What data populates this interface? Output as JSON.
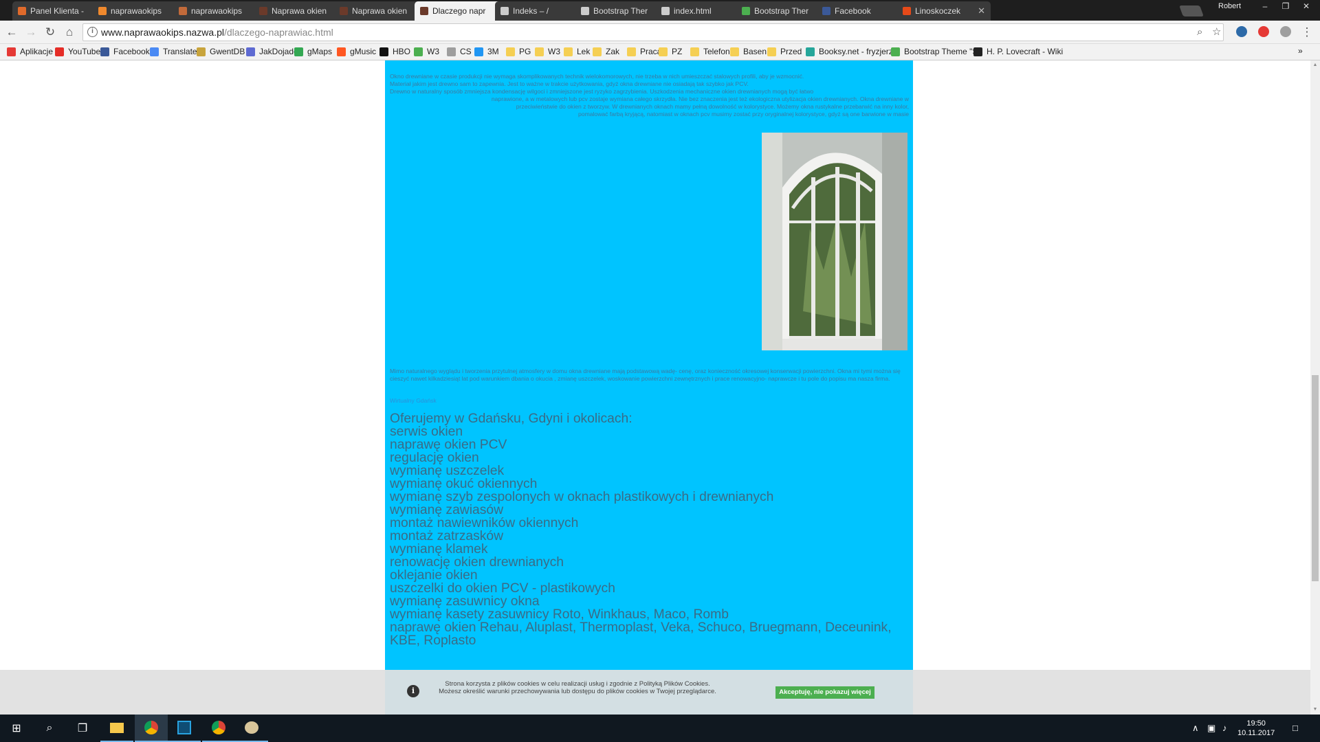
{
  "browser": {
    "tabs": [
      {
        "label": "Panel Klienta -",
        "icon_color": "#e06a2b"
      },
      {
        "label": "naprawaokips",
        "icon_color": "#f0892d"
      },
      {
        "label": "naprawaokips",
        "icon_color": "#c26a3a"
      },
      {
        "label": "Naprawa okien",
        "icon_color": "#6b3a2a"
      },
      {
        "label": "Naprawa okien",
        "icon_color": "#6b3a2a"
      },
      {
        "label": "Dlaczego napr",
        "icon_color": "#6b3a2a"
      },
      {
        "label": "Indeks – /",
        "icon_color": "#cccccc"
      },
      {
        "label": "Bootstrap Ther",
        "icon_color": "#cccccc"
      },
      {
        "label": "index.html",
        "icon_color": "#cccccc"
      },
      {
        "label": "Bootstrap Ther",
        "icon_color": "#4caf50"
      },
      {
        "label": "Facebook",
        "icon_color": "#3b5998"
      },
      {
        "label": "Linoskoczek",
        "icon_color": "#e64a19"
      }
    ],
    "active_tab_index": 5,
    "user_name": "Robert",
    "url_host": "www.naprawaokips.nazwa.pl",
    "url_path": "/dlaczego-naprawiac.html",
    "bookmarks": [
      {
        "label": "Aplikacje",
        "icon_color": "#e53935"
      },
      {
        "label": "YouTube",
        "icon_color": "#e52d27"
      },
      {
        "label": "Facebook",
        "icon_color": "#3b5998"
      },
      {
        "label": "Translate",
        "icon_color": "#4a8af4"
      },
      {
        "label": "GwentDB",
        "icon_color": "#c8a43c"
      },
      {
        "label": "JakDojade",
        "icon_color": "#5e6ad2"
      },
      {
        "label": "gMaps",
        "icon_color": "#34a853"
      },
      {
        "label": "gMusic",
        "icon_color": "#ff5722"
      },
      {
        "label": "HBO",
        "icon_color": "#111111"
      },
      {
        "label": "W3",
        "icon_color": "#4caf50"
      },
      {
        "label": "CS",
        "icon_color": "#9e9e9e"
      },
      {
        "label": "3M",
        "icon_color": "#2196f3"
      },
      {
        "label": "PG",
        "icon_color": "#f5cf53"
      },
      {
        "label": "W3",
        "icon_color": "#f5cf53"
      },
      {
        "label": "Lek",
        "icon_color": "#f5cf53"
      },
      {
        "label": "Zak",
        "icon_color": "#f5cf53"
      },
      {
        "label": "Praca",
        "icon_color": "#f5cf53"
      },
      {
        "label": "PZ",
        "icon_color": "#f5cf53"
      },
      {
        "label": "Telefon",
        "icon_color": "#f5cf53"
      },
      {
        "label": "Basen",
        "icon_color": "#f5cf53"
      },
      {
        "label": "Przed",
        "icon_color": "#f5cf53"
      },
      {
        "label": "Booksy.net - fryzjerzy",
        "icon_color": "#26a69a"
      },
      {
        "label": "Bootstrap Theme \"Si",
        "icon_color": "#4caf50"
      },
      {
        "label": "H. P. Lovecraft - Wiki",
        "icon_color": "#222222"
      }
    ]
  },
  "page": {
    "paragraph1_lines": [
      "Okno drewniane w czasie produkcji nie wymaga skomplikowanych  technik wielokomorowych, nie trzeba w nich umieszczać stalowych profili, aby je wzmocnić.",
      "Materiał jakim jest drewno sam to zapewnia.  Jest to ważne w trakcie użytkowania, gdyż okna drewniane nie osiadają tak szybko jak PCV.",
      "Drewno w naturalny sposób zmniejsza kondensację wilgoci i zmniejszone jest ryzyko zagrzybienia. Uszkodzenia mechaniczne okien drewnianych mogą być łatwo",
      "naprawione, a w metalowych lub pcv zostaje wymiana całego skrzydła. Nie bez znaczenia jest też ekologiczna utylizacja okien drewnianych. Okna drewniane w",
      "przeciwieństwie do okien z tworzyw. W drewnianych oknach mamy pełną dowolność w kolorystyce. Możemy okna rustykalne przebarwić na inny kolor,",
      "pomalować farbą kryjącą, natomiast w oknach pcv musimy zostać przy oryginalnej kolorystyce, gdyż są one barwione w masie"
    ],
    "paragraph2": "Mimo naturalnego wyglądu i tworzenia przytulnej atmosfery w domu okna drewniane mają podstawową wadę- cenę, oraz konieczność okresowej konserwacji powierzchni. Okna mi tymi można się cieszyć nawet kilkadziesiąt lat pod warunkiem dbania o okucia , zmianę uszczelek, woskowanie powierzchni zewnętrznych i prace renowacyjno- naprawcze i tu pole do popisu ma nasza firma.",
    "map_note": "Wirtualny Gdańsk",
    "offer_heading": "Oferujemy w Gdańsku, Gdyni i okolicach:",
    "offer_items": [
      "serwis okien",
      "naprawę okien PCV",
      "regulację okien",
      "wymianę uszczelek",
      "wymianę okuć okiennych",
      "wymianę szyb zespolonych w oknach plastikowych i drewnianych",
      "wymianę zawiasów",
      "montaż nawiewników okiennych",
      "montaż zatrzasków",
      "wymianę klamek",
      "renowację okien drewnianych",
      "oklejanie okien",
      "uszczelki do okien PCV - plastikowych",
      "wymianę zasuwnicy okna",
      "wymianę kasety zasuwnicy Roto, Winkhaus, Maco, Romb",
      "naprawę okien Rehau, Aluplast, Thermoplast, Veka, Schuco, Bruegmann, Deceunink, KBE, Roplasto"
    ],
    "background_color": "#00c4ff"
  },
  "cookie_bar": {
    "text": "Strona korzysta z plików cookies w celu realizacji usług i zgodnie z Polityką Plików Cookies. Możesz określić warunki przechowywania lub dostępu do plików cookies w Twojej przeglądarce.",
    "accept_label": "Akceptuję, nie pokazuj więcej"
  },
  "taskbar": {
    "time": "19:50",
    "date": "10.11.2017"
  }
}
